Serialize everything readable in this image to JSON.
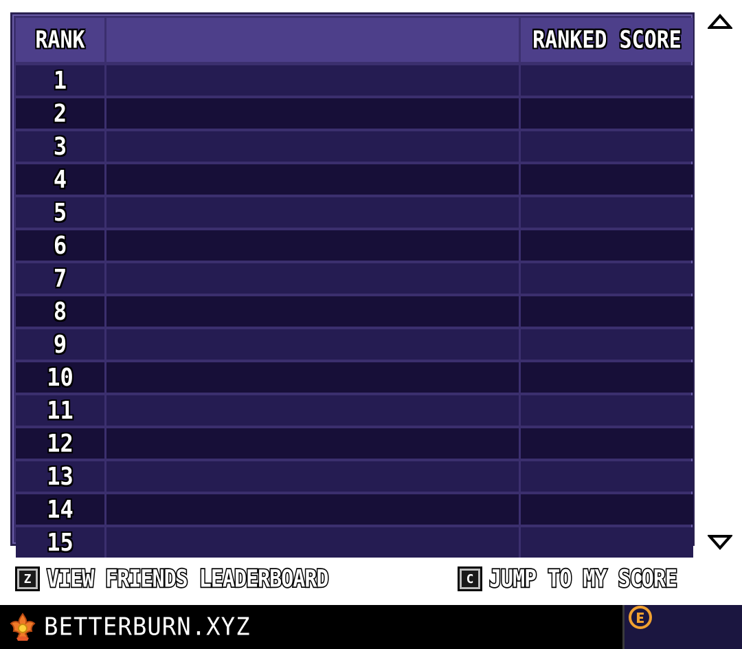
{
  "leaderboard": {
    "headers": {
      "rank": "RANK",
      "name": "",
      "score": "RANKED SCORE"
    },
    "rows": [
      {
        "rank": "1",
        "name": "",
        "score": ""
      },
      {
        "rank": "2",
        "name": "",
        "score": ""
      },
      {
        "rank": "3",
        "name": "",
        "score": ""
      },
      {
        "rank": "4",
        "name": "",
        "score": ""
      },
      {
        "rank": "5",
        "name": "",
        "score": ""
      },
      {
        "rank": "6",
        "name": "",
        "score": ""
      },
      {
        "rank": "7",
        "name": "",
        "score": ""
      },
      {
        "rank": "8",
        "name": "",
        "score": ""
      },
      {
        "rank": "9",
        "name": "",
        "score": ""
      },
      {
        "rank": "10",
        "name": "",
        "score": ""
      },
      {
        "rank": "11",
        "name": "",
        "score": ""
      },
      {
        "rank": "12",
        "name": "",
        "score": ""
      },
      {
        "rank": "13",
        "name": "",
        "score": ""
      },
      {
        "rank": "14",
        "name": "",
        "score": ""
      },
      {
        "rank": "15",
        "name": "",
        "score": ""
      }
    ]
  },
  "scroll": {
    "up_icon": "arrow-up-icon",
    "down_icon": "arrow-down-icon"
  },
  "prompts": {
    "friends": {
      "key": "Z",
      "label": "VIEW FRIENDS LEADERBOARD"
    },
    "jump": {
      "key": "C",
      "label": "JUMP TO MY SCORE"
    }
  },
  "footer": {
    "brand": "BETTERBURN.XYZ",
    "logo_icon": "flame-flower-icon",
    "emblem_icon": "coin-emblem-icon"
  },
  "colors": {
    "header_bg": "#4d3f8a",
    "row_odd": "#251c52",
    "row_even": "#170f38",
    "frame": "#3b2f6e",
    "footer_bg": "#000000",
    "logo_orange": "#f07a28",
    "emblem_gold": "#f0a030"
  }
}
